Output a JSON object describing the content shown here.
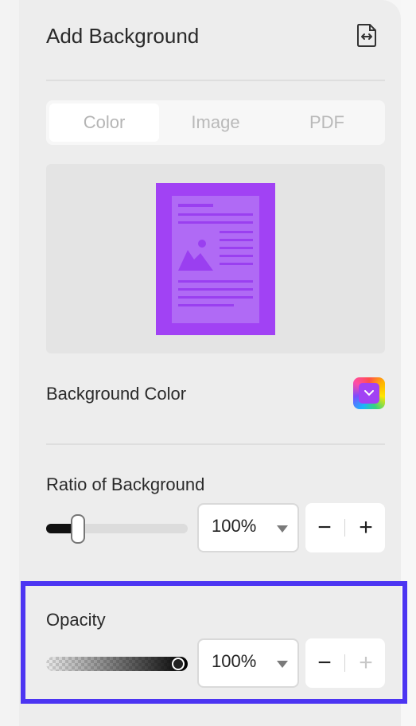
{
  "panel": {
    "title": "Add Background",
    "export_icon": "file-swap-icon"
  },
  "tabs": [
    {
      "label": "Color",
      "active": true
    },
    {
      "label": "Image",
      "active": false
    },
    {
      "label": "PDF",
      "active": false
    }
  ],
  "background_color": {
    "label": "Background Color",
    "value": "#a142f4"
  },
  "ratio": {
    "label": "Ratio of Background",
    "value": "100%",
    "slider_fraction": 0.22,
    "minus": "−",
    "plus": "+"
  },
  "opacity": {
    "label": "Opacity",
    "value": "100%",
    "slider_fraction": 1.0,
    "minus": "−",
    "plus": "+"
  },
  "colors": {
    "highlight": "#4c35f2",
    "accent": "#a142f4"
  }
}
